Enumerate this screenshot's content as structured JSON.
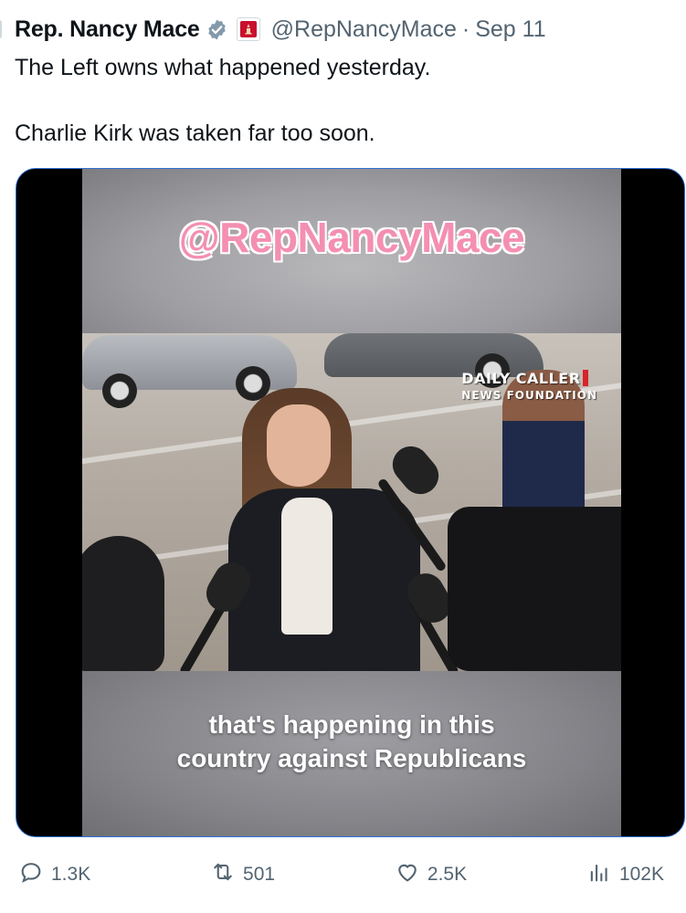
{
  "tweet": {
    "display_name": "Rep. Nancy Mace",
    "handle": "@RepNancyMace",
    "separator": "·",
    "date": "Sep 11",
    "text": "The Left owns what happened yesterday.\n\nCharlie Kirk was taken far too soon.",
    "badges": [
      "verified-badge-icon",
      "government-flag-icon"
    ],
    "badge_colors": {
      "verified": "#829aab",
      "government": "#c8102e"
    }
  },
  "media": {
    "overlay_handle": "@RepNancyMace",
    "watermark_line1": "DAILY CALLER",
    "watermark_line2": "NEWS FOUNDATION",
    "caption": "that's happening in this\ncountry against Republicans",
    "border_color": "#2f6fd4"
  },
  "actions": {
    "replies": "1.3K",
    "reposts": "501",
    "likes": "2.5K",
    "views": "102K",
    "icons": [
      "reply-icon",
      "repost-icon",
      "like-icon",
      "views-icon"
    ]
  }
}
